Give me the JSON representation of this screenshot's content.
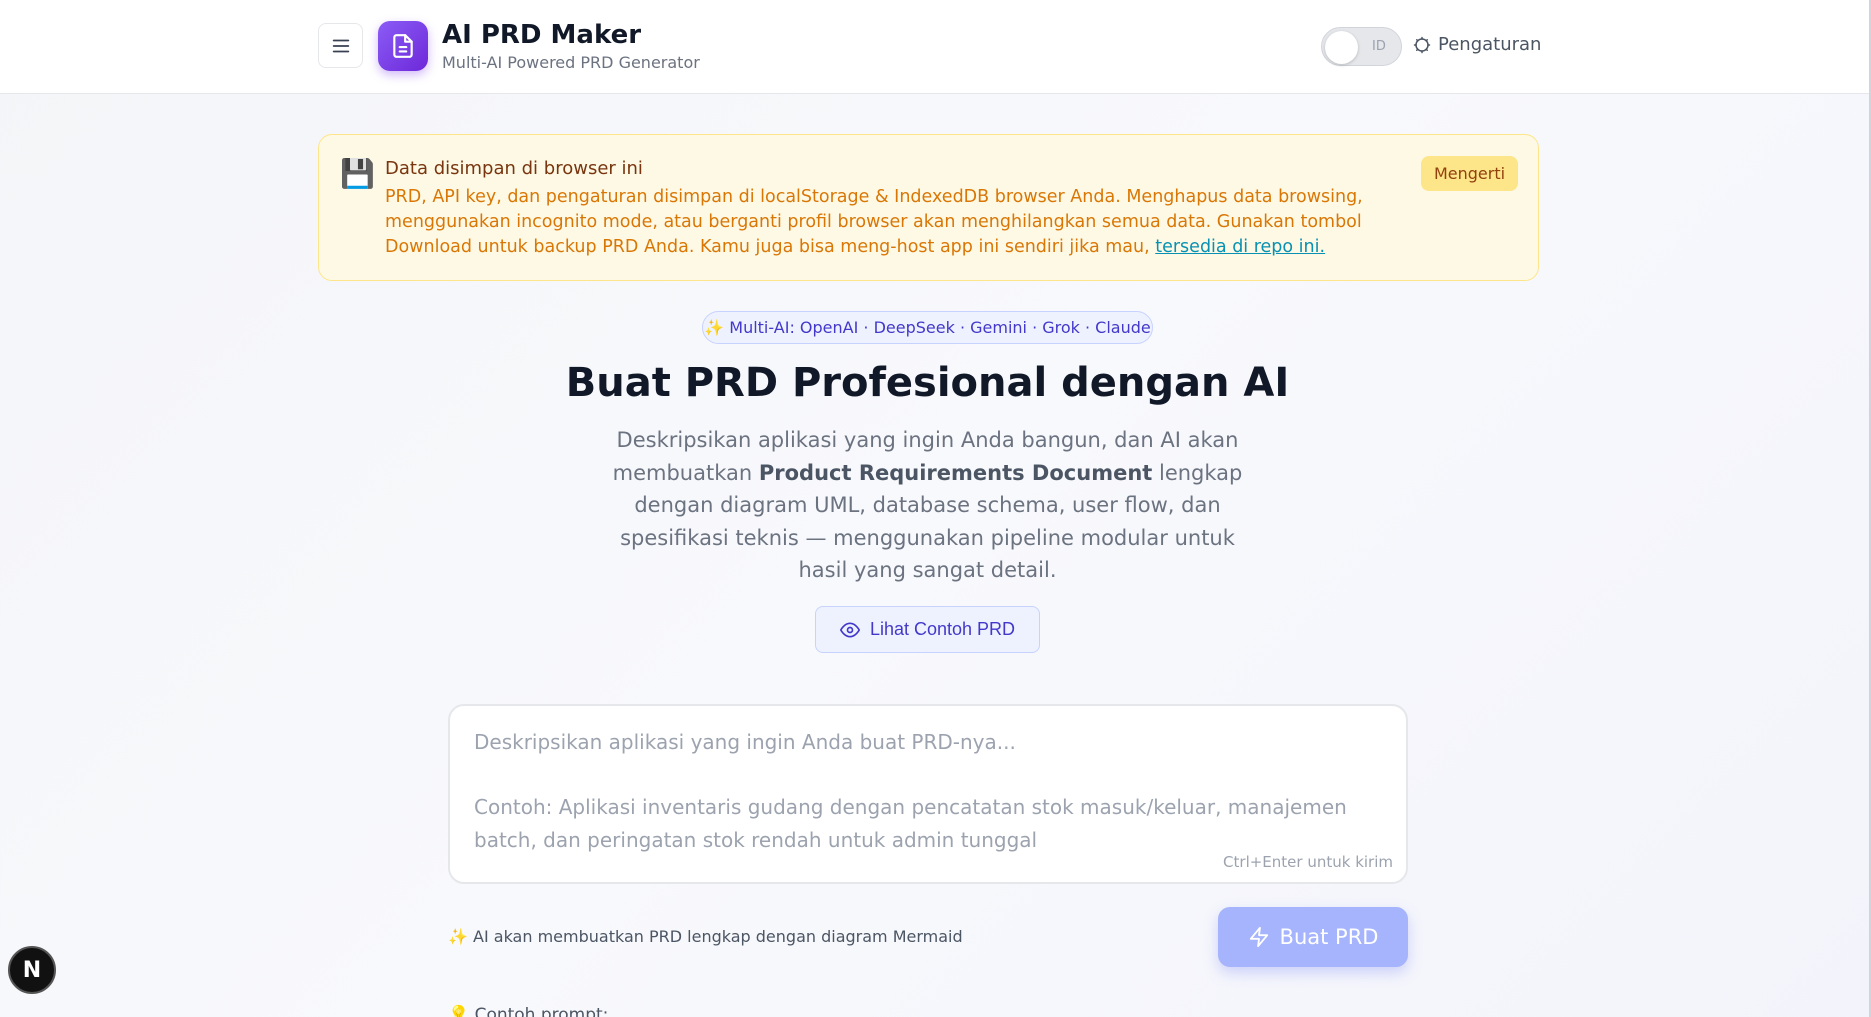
{
  "header": {
    "title": "AI PRD Maker",
    "subtitle": "Multi-AI Powered PRD Generator",
    "language_toggle": "ID",
    "settings_label": "Pengaturan",
    "icons": {
      "menu": "hamburger-icon",
      "logo": "document-icon",
      "settings": "gear-icon"
    }
  },
  "notice": {
    "icon": "💾",
    "title": "Data disimpan di browser ini",
    "body": "PRD, API key, dan pengaturan disimpan di localStorage & IndexedDB browser Anda. Menghapus data browsing, menggunakan incognito mode, atau berganti profil browser akan menghilangkan semua data. Gunakan tombol Download untuk backup PRD Anda. Kamu juga bisa meng-host app ini sendiri jika mau, ",
    "link_text": "tersedia di repo ini.",
    "dismiss_label": "Mengerti"
  },
  "hero": {
    "pill": "✨ Multi-AI: OpenAI · DeepSeek · Gemini · Grok · Claude",
    "title": "Buat PRD Profesional dengan AI",
    "desc_before": "Deskripsikan aplikasi yang ingin Anda bangun, dan AI akan membuatkan ",
    "desc_bold": "Product Requirements Document",
    "desc_after": " lengkap dengan diagram UML, database schema, user flow, dan spesifikasi teknis — menggunakan pipeline modular untuk hasil yang sangat detail.",
    "example_button": "Lihat Contoh PRD"
  },
  "prompt": {
    "placeholder": "Deskripsikan aplikasi yang ingin Anda buat PRD-nya...\n\nContoh: Aplikasi inventaris gudang dengan pencatatan stok masuk/keluar, manajemen batch, dan peringatan stok rendah untuk admin tunggal",
    "value": "",
    "hint": "Ctrl+Enter untuk kirim",
    "ai_note": "✨ AI akan membuatkan PRD lengkap dengan diagram Mermaid",
    "generate_button": "Buat PRD",
    "examples_label": "💡 Contoh prompt:"
  },
  "badge": {
    "letter": "N"
  },
  "colors": {
    "accent": "#7c3aed",
    "indigo": "#4338ca",
    "notice_bg": "#fef9e4",
    "notice_text": "#d97706",
    "button_disabled": "#a5b4fc"
  }
}
